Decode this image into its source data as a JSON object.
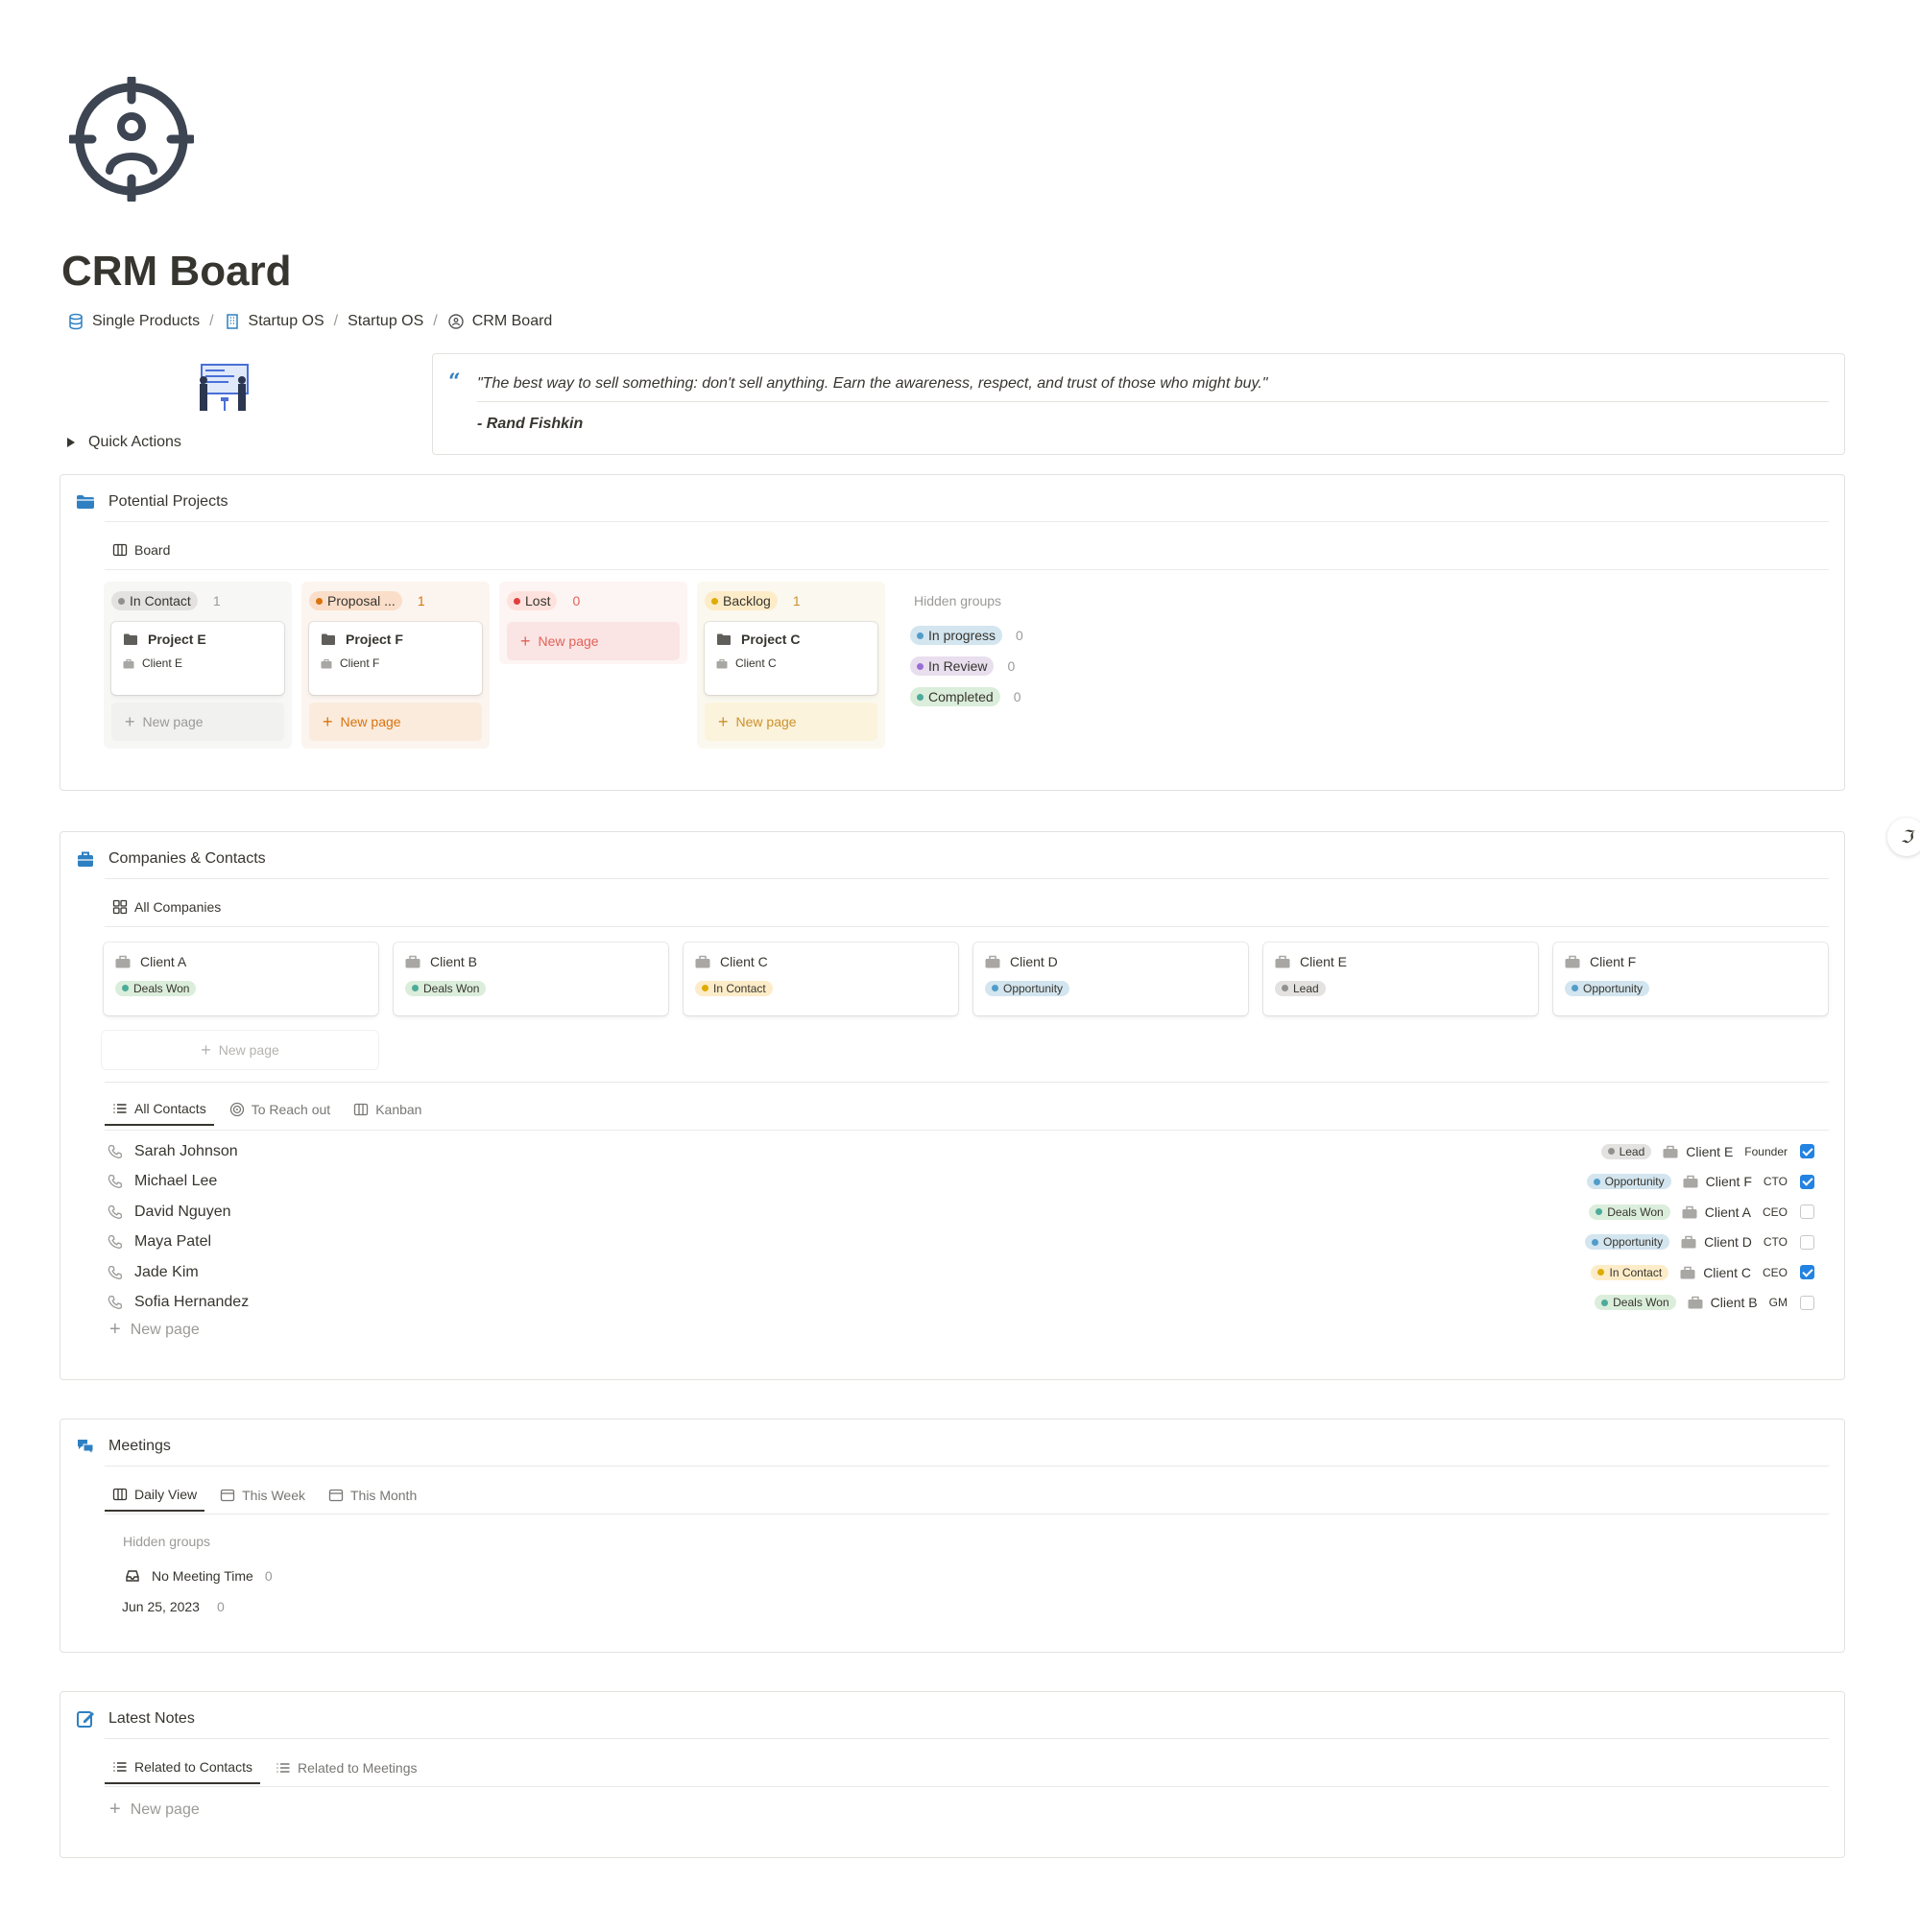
{
  "page": {
    "title": "CRM Board",
    "icon": "crosshair-person-icon",
    "breadcrumb": [
      "Single Products",
      "Startup OS",
      "Startup OS",
      "CRM Board"
    ]
  },
  "quick_actions": {
    "label": "Quick Actions"
  },
  "quote": {
    "text": "\"The best way to sell something: don't sell anything. Earn the awareness, respect, and trust of those who might buy.\"",
    "author": "- Rand Fishkin"
  },
  "potential_projects": {
    "title": "Potential Projects",
    "view": "Board",
    "columns": [
      {
        "label": "In Contact",
        "count": "1",
        "card_title": "Project E",
        "card_client": "Client E",
        "new_page": "New page"
      },
      {
        "label": "Proposal ...",
        "count": "1",
        "card_title": "Project F",
        "card_client": "Client F",
        "new_page": "New page"
      },
      {
        "label": "Lost",
        "count": "0",
        "new_page": "New page"
      },
      {
        "label": "Backlog",
        "count": "1",
        "card_title": "Project C",
        "card_client": "Client C",
        "new_page": "New page"
      }
    ],
    "hidden_groups": {
      "label": "Hidden groups",
      "groups": [
        {
          "label": "In progress",
          "count": "0"
        },
        {
          "label": "In Review",
          "count": "0"
        },
        {
          "label": "Completed",
          "count": "0"
        }
      ]
    }
  },
  "companies": {
    "title": "Companies & Contacts",
    "view": "All Companies",
    "cards": [
      {
        "name": "Client A",
        "status": "Deals Won"
      },
      {
        "name": "Client B",
        "status": "Deals Won"
      },
      {
        "name": "Client C",
        "status": "In Contact"
      },
      {
        "name": "Client D",
        "status": "Opportunity"
      },
      {
        "name": "Client E",
        "status": "Lead"
      },
      {
        "name": "Client F",
        "status": "Opportunity"
      }
    ],
    "new_page": "New page",
    "contact_tabs": [
      "All Contacts",
      "To Reach out",
      "Kanban"
    ],
    "contacts": [
      {
        "name": "Sarah Johnson",
        "status": "Lead",
        "company": "Client E",
        "role": "Founder",
        "checked": true
      },
      {
        "name": "Michael Lee",
        "status": "Opportunity",
        "company": "Client F",
        "role": "CTO",
        "checked": true
      },
      {
        "name": "David Nguyen",
        "status": "Deals Won",
        "company": "Client A",
        "role": "CEO",
        "checked": false
      },
      {
        "name": "Maya Patel",
        "status": "Opportunity",
        "company": "Client D",
        "role": "CTO",
        "checked": false
      },
      {
        "name": "Jade Kim",
        "status": "In Contact",
        "company": "Client C",
        "role": "CEO",
        "checked": true
      },
      {
        "name": "Sofia Hernandez",
        "status": "Deals Won",
        "company": "Client B",
        "role": "GM",
        "checked": false
      }
    ],
    "contacts_new_page": "New page"
  },
  "meetings": {
    "title": "Meetings",
    "tabs": [
      "Daily View",
      "This Week",
      "This Month"
    ],
    "hidden_label": "Hidden groups",
    "no_meeting": {
      "label": "No Meeting Time",
      "count": "0"
    },
    "date_group": {
      "label": "Jun 25, 2023",
      "count": "0"
    }
  },
  "notes": {
    "title": "Latest Notes",
    "tabs": [
      "Related to Contacts",
      "Related to Meetings"
    ],
    "new_page": "New page"
  },
  "colors": {
    "gray_tag": "#e3e2e0",
    "orange_tag": "#fadec9",
    "red_tag": "#ffe2dd",
    "yellow_tag": "#fdecc8",
    "blue_tag": "#d3e5ef",
    "purple_tag": "#e8deee",
    "green_tag": "#dbeddb",
    "checkbox_blue": "#2383e2"
  }
}
